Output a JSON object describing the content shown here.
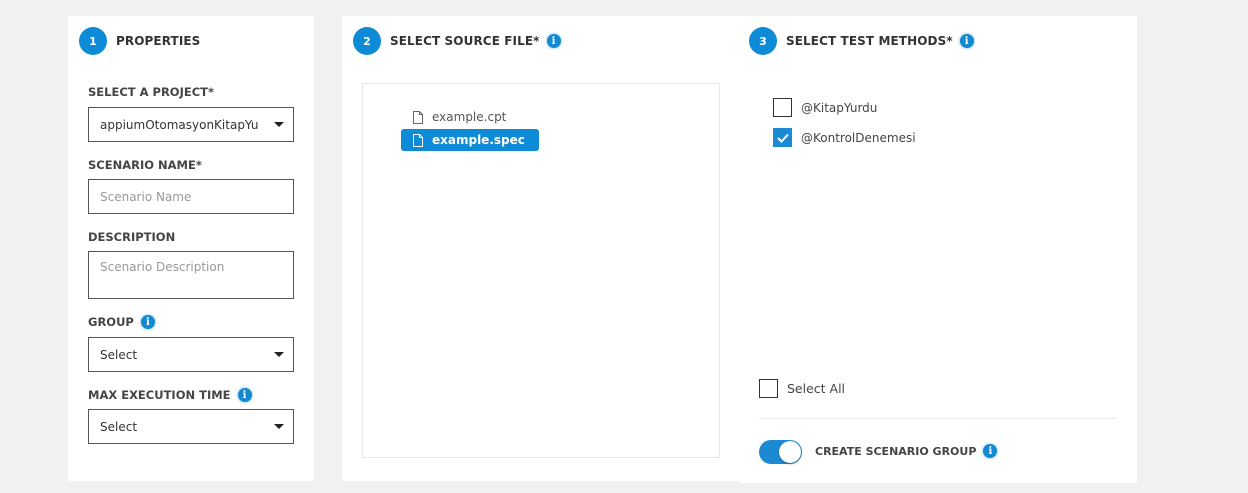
{
  "properties": {
    "step": "1",
    "title": "PROPERTIES",
    "project_label": "SELECT A PROJECT*",
    "project_value": "appiumOtomasyonKitapYu",
    "scenario_name_label": "SCENARIO NAME*",
    "scenario_name_placeholder": "Scenario Name",
    "description_label": "DESCRIPTION",
    "description_placeholder": "Scenario Description",
    "group_label": "GROUP",
    "group_value": "Select",
    "max_time_label": "MAX EXECUTION TIME",
    "max_time_value": "Select"
  },
  "source": {
    "step": "2",
    "title": "SELECT SOURCE FILE*",
    "files": [
      {
        "name": "example.cpt",
        "selected": false
      },
      {
        "name": "example.spec",
        "selected": true
      }
    ]
  },
  "methods": {
    "step": "3",
    "title": "SELECT TEST METHODS*",
    "items": [
      {
        "label": "@KitapYurdu",
        "checked": false
      },
      {
        "label": "@KontrolDenemesi",
        "checked": true
      }
    ],
    "select_all_label": "Select All",
    "select_all_checked": false,
    "create_group_label": "CREATE SCENARIO GROUP",
    "create_group_on": true
  },
  "info_glyph": "i",
  "colors": {
    "accent": "#0e8bd6",
    "background": "#f1f1f1"
  }
}
